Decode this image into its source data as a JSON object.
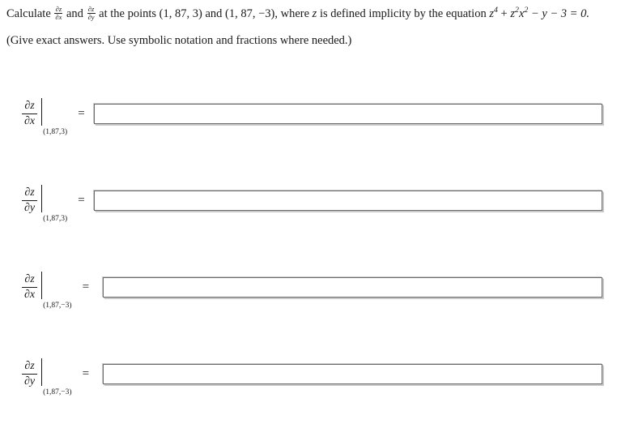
{
  "question": {
    "line1": {
      "lead": "Calculate",
      "frac1": {
        "num": "∂z",
        "den": "∂x"
      },
      "conj": "and",
      "frac2": {
        "num": "∂z",
        "den": "∂y"
      },
      "mid": "at the points (1, 87, 3) and (1, 87, −3), where",
      "var": "z",
      "tail_before_eq": "is defined implicity by the equation",
      "equation": {
        "term1_base": "z",
        "term1_exp": "4",
        "plus": "+",
        "term2_base1": "z",
        "term2_exp1": "2",
        "term2_base2": "x",
        "term2_exp2": "2",
        "term3": "− y − 3 = 0.",
        "full_text": "z⁴ + z²x² − y − 3 = 0."
      }
    },
    "line2": "(Give exact answers. Use symbolic notation and fractions where needed.)"
  },
  "answers": [
    {
      "name": "dz-dx-at-1-87-3",
      "derivative": {
        "num": "∂z",
        "den": "∂x"
      },
      "evaluated_at": "(1,87,3)",
      "equals": "=",
      "value": "",
      "placeholder": ""
    },
    {
      "name": "dz-dy-at-1-87-3",
      "derivative": {
        "num": "∂z",
        "den": "∂y"
      },
      "evaluated_at": "(1,87,3)",
      "equals": "=",
      "value": "",
      "placeholder": ""
    },
    {
      "name": "dz-dx-at-1-87-neg3",
      "derivative": {
        "num": "∂z",
        "den": "∂x"
      },
      "evaluated_at": "(1,87,−3)",
      "equals": "=",
      "value": "",
      "placeholder": ""
    },
    {
      "name": "dz-dy-at-1-87-neg3",
      "derivative": {
        "num": "∂z",
        "den": "∂y"
      },
      "evaluated_at": "(1,87,−3)",
      "equals": "=",
      "value": "",
      "placeholder": ""
    }
  ],
  "colors": {
    "text": "#1a1a1a",
    "input_border": "#6b6b6b",
    "input_shadow": "#c9c9c9",
    "background": "#ffffff"
  }
}
